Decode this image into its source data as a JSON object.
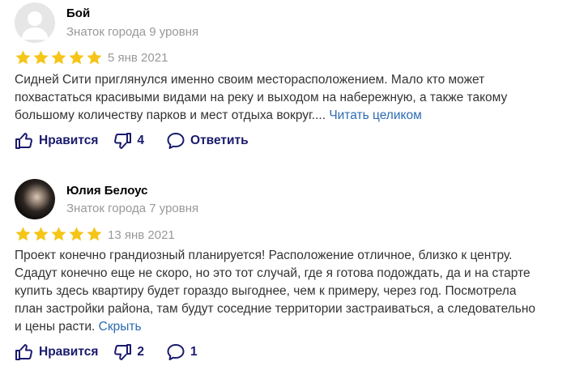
{
  "reviews": [
    {
      "author": "Бой",
      "level": "Знаток города 9 уровня",
      "rating": 5,
      "date": "5 янв 2021",
      "text": "Сидней Сити приглянулся именно своим месторасположением. Мало кто может похвастаться красивыми видами на реку и выходом на набережную, а также такому большому количеству парков и мест отдыха вокруг....",
      "more_label": "Читать целиком",
      "like_label": "Нравится",
      "dislike_count": "4",
      "reply_label": "Ответить"
    },
    {
      "author": "Юлия Белоус",
      "level": "Знаток города 7 уровня",
      "rating": 5,
      "date": "13 янв 2021",
      "text": "Проект конечно грандиозный планируется! Расположение отличное, близко к центру. Сдадут конечно еще не скоро, но это тот случай, где я готова подождать, да и на старте купить здесь квартиру будет гораздо выгоднее, чем к примеру, через год. Посмотрела план застройки района, там будут соседние территории застраиваться, а следовательно и цены расти.",
      "more_label": "Скрыть",
      "like_label": "Нравится",
      "dislike_count": "2",
      "comment_count": "1"
    }
  ],
  "colors": {
    "star": "#f5c518",
    "link": "#2c6bb3",
    "action": "#1a1a6e"
  }
}
